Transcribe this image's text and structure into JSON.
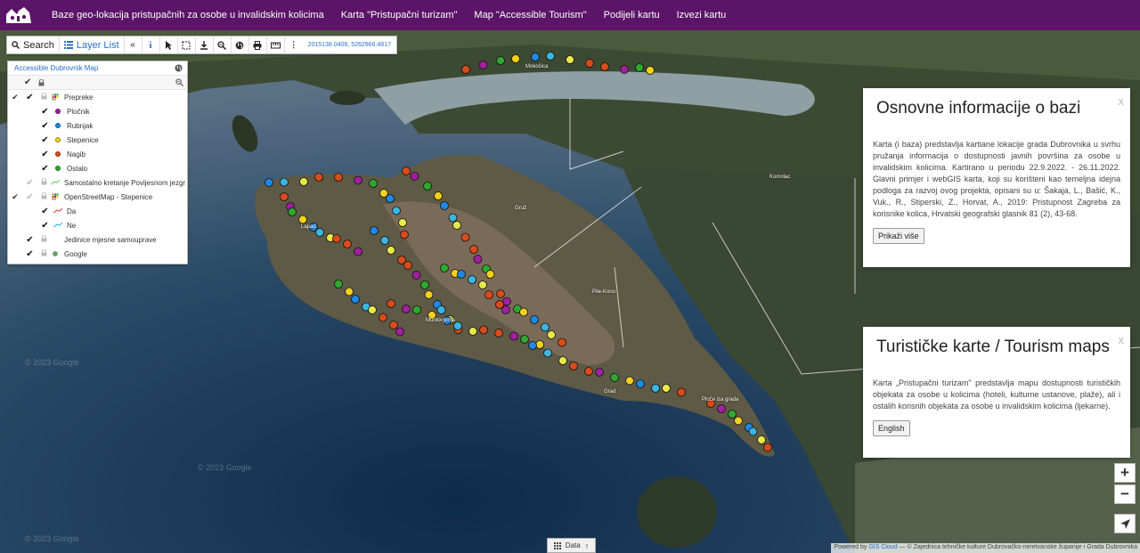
{
  "nav": {
    "items": [
      "Baze geo-lokacija pristupačnih za osobe u invalidskim kolicima",
      "Karta \"Pristupačni turizam\"",
      "Map \"Accessible Tourism\"",
      "Podijeli kartu",
      "Izvezi kartu"
    ]
  },
  "toolbar": {
    "search_label": "Search",
    "layer_list_label": "Layer List",
    "coordinates": "2015138.0406, 5262966.4817"
  },
  "layers": {
    "map_title": "Accessible Dubrovnik Map",
    "items": [
      {
        "label": "Prepreke",
        "color": "#c8a24a"
      },
      {
        "label": "Pločnik",
        "color": "#a020a0"
      },
      {
        "label": "Rubnjak",
        "color": "#1e88e5"
      },
      {
        "label": "Stepenice",
        "color": "#f2d01c"
      },
      {
        "label": "Nagib",
        "color": "#d84b1b"
      },
      {
        "label": "Ostalo",
        "color": "#2ea82e"
      },
      {
        "label": "Samostalno kretanje Povijesnom jezgr",
        "color": "#7fd67f"
      },
      {
        "label": "OpenStreetMap - Stepenice",
        "color": "#c8a24a"
      },
      {
        "label": "Da",
        "color": "#e05555"
      },
      {
        "label": "Ne",
        "color": "#3cb5e0"
      },
      {
        "label": "Jedinice mjesne samouprave",
        "color": ""
      },
      {
        "label": "Google",
        "color": "#4caf50"
      }
    ]
  },
  "info1": {
    "title": "Osnovne informacije o bazi",
    "text": "Karta (i baza) predstavlja kartiane lokacije grada Dubrovnika u svrhu pružanja informacija o dostupnosti javnih površina za osobe u invalidskim kolicima. Kartirano u periodu 22.9.2022. - 26.11.2022. Glavni primjer i webGIS karta, koji su korišteni kao temeljna idejna podloga za razvoj ovog projekta, opisani su u: Šakaja, L., Bašić, K., Vuk., R., Stiperski, Z., Horvat, A., 2019: Pristupnost Zagreba za korisnike kolica, Hrvatski geografski glasnik 81 (2), 43-68.",
    "button": "Prikaži više",
    "close": "x"
  },
  "info2": {
    "title": "Turističke karte / Tourism maps",
    "text": "Karta „Pristupačni turizam\" predstavlja mapu dostupnosti turističkih objekata za osobe u kolicima (hoteli, kulturne ustanove, plaže), ali i ostalih korisnih objekata za osobe u invalidskim kolicima (ljekarne).",
    "button": "English",
    "close": "x"
  },
  "map": {
    "labels": {
      "mokosica": "Mokošica",
      "komolac": "Komolac",
      "gruz": "Gruž",
      "lapad": "Lapad",
      "pile_kono": "Pile-Kono",
      "montovjerna": "Montovjerna",
      "grad": "Grad",
      "ploce": "Ploče iza grada"
    },
    "watermark": "© 2023 Google",
    "data_button": "Data",
    "attribution_prefix": "Powered by",
    "attribution_link": "GIS Cloud",
    "attribution_rest": "— © Zajednica tehničke kulture Dubrovačko-neretvanske županije i Grada Dubrovnika"
  },
  "colors": {
    "nav_bg": "#5b1467",
    "accent": "#2a6fc9"
  }
}
